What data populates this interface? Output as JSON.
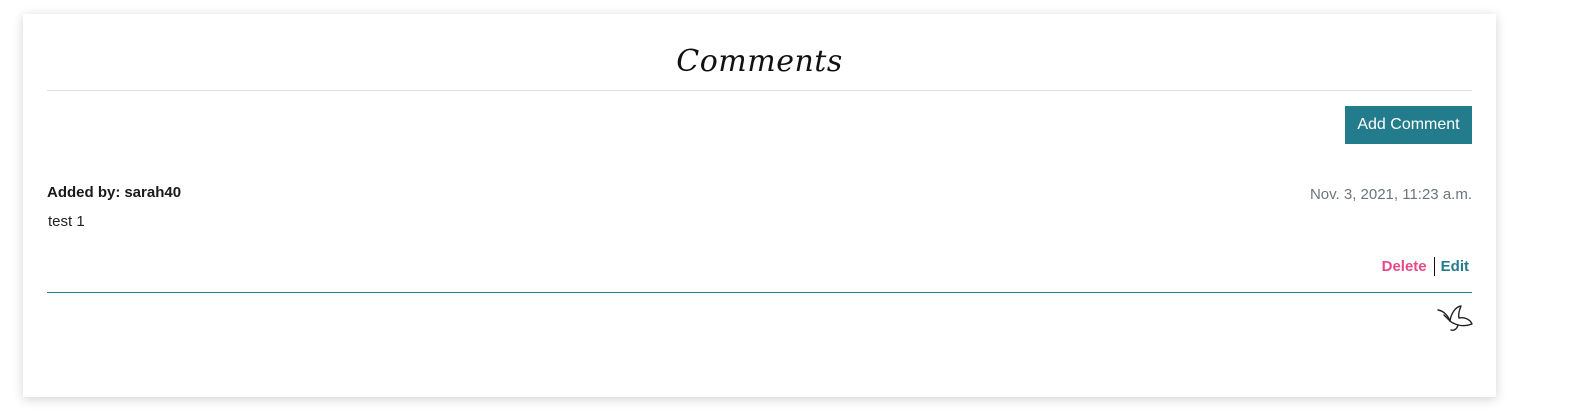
{
  "section": {
    "title": "Comments",
    "add_button_label": "Add Comment"
  },
  "comments": [
    {
      "author_prefix": "Added by:",
      "author": "sarah40",
      "timestamp": "Nov. 3, 2021, 11:23 a.m.",
      "body": "test 1",
      "delete_label": "Delete",
      "edit_label": "Edit"
    }
  ],
  "colors": {
    "accent": "#237c8b",
    "delete": "#e8488a",
    "timestamp": "#6c757d"
  },
  "icons": {
    "footer": "bird-icon"
  }
}
